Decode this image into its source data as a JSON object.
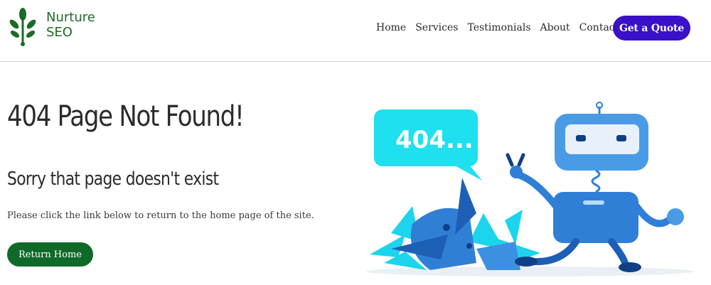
{
  "header": {
    "brand_line1": "Nurture",
    "brand_line2": "SEO",
    "nav": [
      "Home",
      "Services",
      "Testimonials",
      "About",
      "Contact"
    ],
    "cta_label": "Get a Quote"
  },
  "main": {
    "title": "404 Page Not Found!",
    "subtitle": "Sorry that page doesn't exist",
    "message": "Please click the link below to return to the home page of the site.",
    "button_label": "Return Home",
    "illustration_text": "404..."
  },
  "colors": {
    "brand_green": "#1a6b27",
    "cta_purple": "#3a10c8",
    "button_green": "#0f6a2a",
    "robot_blue": "#2f7fd6",
    "bubble_cyan": "#1ee0ef"
  },
  "icons": {
    "logo": "leaf-plant-icon"
  }
}
